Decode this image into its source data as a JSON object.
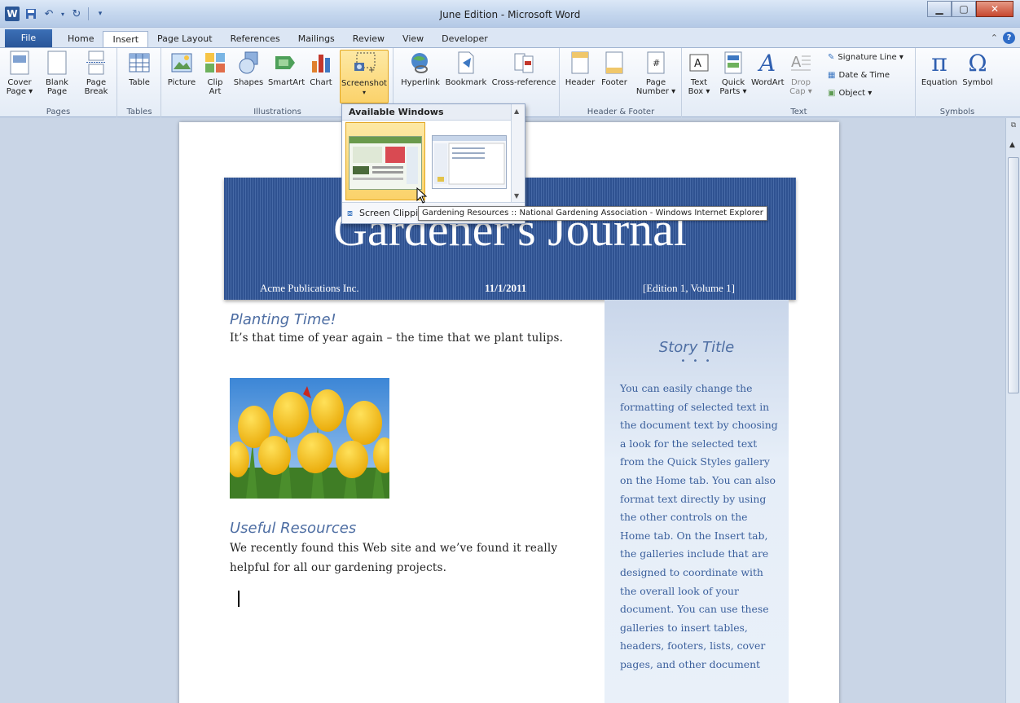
{
  "window": {
    "title": "June Edition - Microsoft Word",
    "logo_letter": "W"
  },
  "tabs": {
    "file": "File",
    "items": [
      "Home",
      "Insert",
      "Page Layout",
      "References",
      "Mailings",
      "Review",
      "View",
      "Developer"
    ],
    "active": "Insert",
    "help": "?"
  },
  "ribbon": {
    "pages": {
      "label": "Pages",
      "cover": "Cover Page ▾",
      "blank": "Blank Page",
      "break": "Page Break"
    },
    "tables": {
      "label": "Tables",
      "table": "Table"
    },
    "illustrations": {
      "label": "Illustrations",
      "picture": "Picture",
      "clipart": "Clip Art",
      "shapes": "Shapes",
      "smartart": "SmartArt",
      "chart": "Chart",
      "screenshot": "Screenshot"
    },
    "links": {
      "hyperlink": "Hyperlink",
      "bookmark": "Bookmark",
      "crossref": "Cross-reference"
    },
    "header_footer": {
      "label": "Header & Footer",
      "header": "Header",
      "footer": "Footer",
      "page_number": "Page Number ▾"
    },
    "text": {
      "label": "Text",
      "textbox": "Text Box ▾",
      "quickparts": "Quick Parts ▾",
      "wordart": "WordArt",
      "dropcap": "Drop Cap ▾",
      "signature": "Signature Line ▾",
      "datetime": "Date & Time",
      "object": "Object ▾"
    },
    "symbols": {
      "label": "Symbols",
      "equation": "Equation",
      "symbol": "Symbol"
    }
  },
  "screenshot_menu": {
    "header": "Available Windows",
    "footer": "Screen Clipping",
    "tooltip": "Gardening Resources :: National Gardening Association - Windows Internet Explorer"
  },
  "document": {
    "banner_title": "Gardener's Journal",
    "publisher": "Acme Publications Inc.",
    "date": "11/1/2011",
    "edition": "[Edition 1, Volume 1]",
    "heading1": "Planting Time!",
    "para1": "It’s that time of year again – the time that we plant tulips.",
    "heading2": "Useful Resources",
    "para2": "We recently found this Web site and we’ve found it really helpful for all our gardening projects.",
    "sidebar_title": "Story Title",
    "sidebar_dots": "• • •",
    "sidebar_text": "You can easily change the formatting of selected text in the document text by choosing a look for the selected text from the Quick Styles gallery on the Home tab. You can also format text directly by using the other controls on the Home tab. On the Insert tab, the galleries include that are designed to coordinate with the overall look of your document. You can use these galleries to insert tables, headers, footers, lists, cover pages, and other document"
  },
  "colors": {
    "accent": "#2b5797",
    "heading": "#4e6ea3",
    "banner": "#2f5291",
    "highlight": "#fbd26a"
  }
}
